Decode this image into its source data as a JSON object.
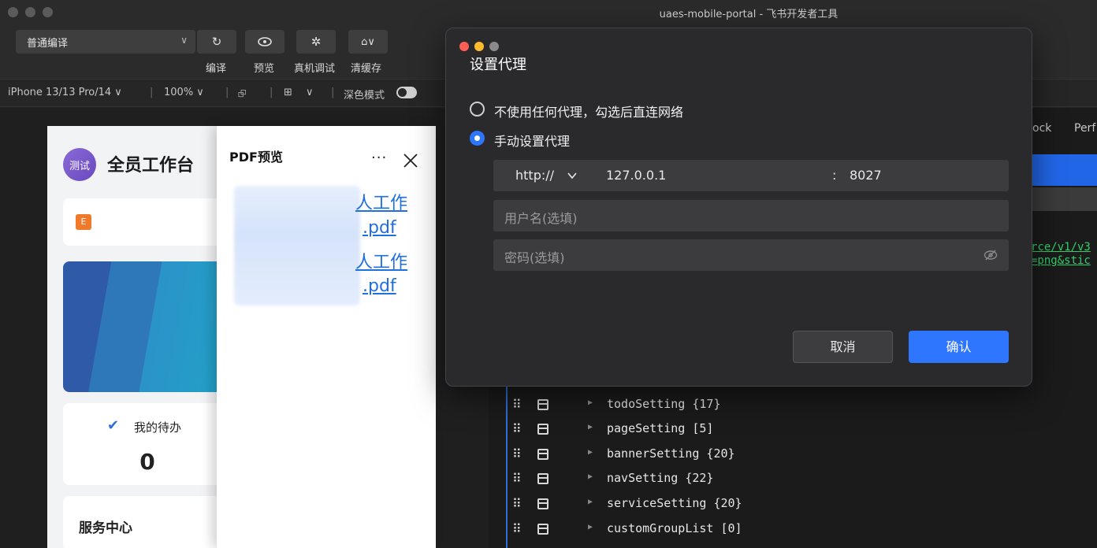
{
  "window": {
    "title": "uaes-mobile-portal - 飞书开发者工具"
  },
  "toolbar": {
    "compile_mode": "普通编译",
    "compile_label": "编译",
    "preview_label": "预览",
    "debug_label": "真机调试",
    "clear_cache_label": "清缓存"
  },
  "devicebar": {
    "device": "iPhone 13/13 Pro/14 ∨",
    "zoom": "100% ∨",
    "layout": "∨",
    "dark_mode_label": "深色模式"
  },
  "simulator": {
    "avatar_text": "测试",
    "app_title": "全员工作台",
    "office_icon_text": "E",
    "todo_label": "我的待办",
    "todo_count": "0",
    "service_title": "服务中心"
  },
  "pdf_panel": {
    "title": "PDF预览",
    "more": "···",
    "links": [
      {
        "line1": "人工作",
        "line2": ".pdf"
      },
      {
        "line1": "人工作",
        "line2": ".pdf"
      }
    ]
  },
  "devtools": {
    "tabs": [
      "ock",
      "Perf"
    ],
    "url_lines": [
      "rce/v1/v3",
      "=png&stic"
    ],
    "tree": [
      "todoSetting {17}",
      "pageSetting [5]",
      "bannerSetting {20}",
      "navSetting {22}",
      "serviceSetting {20}",
      "customGroupList [0]"
    ]
  },
  "proxy_dialog": {
    "title": "设置代理",
    "option_no_proxy": "不使用任何代理，勾选后直连网络",
    "option_manual": "手动设置代理",
    "protocol": "http://",
    "host": "127.0.0.1",
    "colon": ":",
    "port": "8027",
    "username_placeholder": "用户名(选填)",
    "password_placeholder": "密码(选填)",
    "cancel_label": "取消",
    "confirm_label": "确认",
    "colors": {
      "accent": "#2f76ff",
      "close": "#ff5f57",
      "minimize": "#febc2e",
      "disabled": "#8a8a8a"
    }
  }
}
